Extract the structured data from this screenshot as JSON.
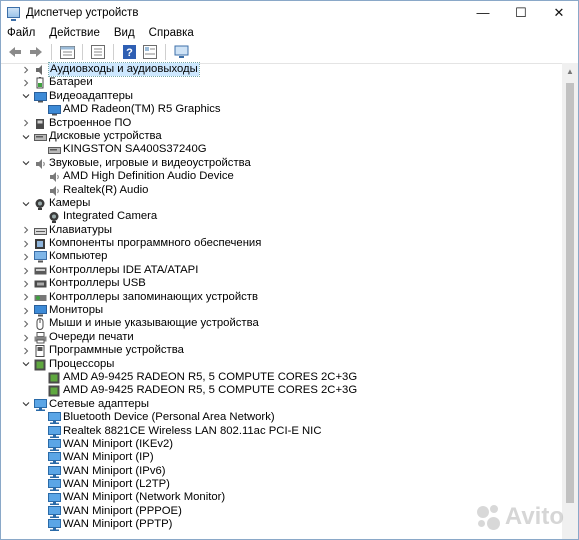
{
  "window": {
    "title": "Диспетчер устройств",
    "minimize": "—",
    "maximize": "☐",
    "close": "✕"
  },
  "menu": [
    "Файл",
    "Действие",
    "Вид",
    "Справка"
  ],
  "toolbar": [
    "back-arrow-icon",
    "forward-arrow-icon",
    "properties-icon",
    "list-icon",
    "help-icon",
    "scan-hardware-icon"
  ],
  "tree": [
    {
      "level": 0,
      "expand": ">",
      "icon": "audio-io-icon",
      "label": "Аудиовходы и аудиовыходы",
      "selected": true
    },
    {
      "level": 0,
      "expand": ">",
      "icon": "battery-icon",
      "label": "Батареи"
    },
    {
      "level": 0,
      "expand": "v",
      "icon": "display-adapter-icon",
      "label": "Видеоадаптеры"
    },
    {
      "level": 1,
      "icon": "display-adapter-icon",
      "label": "AMD Radeon(TM) R5 Graphics"
    },
    {
      "level": 0,
      "expand": ">",
      "icon": "firmware-icon",
      "label": "Встроенное ПО"
    },
    {
      "level": 0,
      "expand": "v",
      "icon": "disk-icon",
      "label": "Дисковые устройства"
    },
    {
      "level": 1,
      "icon": "disk-icon",
      "label": "KINGSTON SA400S37240G"
    },
    {
      "level": 0,
      "expand": "v",
      "icon": "speaker-icon",
      "label": "Звуковые, игровые и видеоустройства"
    },
    {
      "level": 1,
      "icon": "speaker-icon",
      "label": "AMD High Definition Audio Device"
    },
    {
      "level": 1,
      "icon": "speaker-icon",
      "label": "Realtek(R) Audio"
    },
    {
      "level": 0,
      "expand": "v",
      "icon": "camera-icon",
      "label": "Камеры"
    },
    {
      "level": 1,
      "icon": "camera-icon",
      "label": "Integrated Camera"
    },
    {
      "level": 0,
      "expand": ">",
      "icon": "keyboard-icon",
      "label": "Клавиатуры"
    },
    {
      "level": 0,
      "expand": ">",
      "icon": "software-component-icon",
      "label": "Компоненты программного обеспечения"
    },
    {
      "level": 0,
      "expand": ">",
      "icon": "computer-icon",
      "label": "Компьютер"
    },
    {
      "level": 0,
      "expand": ">",
      "icon": "ide-controller-icon",
      "label": "Контроллеры IDE ATA/ATAPI"
    },
    {
      "level": 0,
      "expand": ">",
      "icon": "usb-icon",
      "label": "Контроллеры USB"
    },
    {
      "level": 0,
      "expand": ">",
      "icon": "storage-controller-icon",
      "label": "Контроллеры запоминающих устройств"
    },
    {
      "level": 0,
      "expand": ">",
      "icon": "monitor-icon",
      "label": "Мониторы"
    },
    {
      "level": 0,
      "expand": ">",
      "icon": "mouse-icon",
      "label": "Мыши и иные указывающие устройства"
    },
    {
      "level": 0,
      "expand": ">",
      "icon": "printer-icon",
      "label": "Очереди печати"
    },
    {
      "level": 0,
      "expand": ">",
      "icon": "software-device-icon",
      "label": "Программные устройства"
    },
    {
      "level": 0,
      "expand": "v",
      "icon": "processor-icon",
      "label": "Процессоры"
    },
    {
      "level": 1,
      "icon": "processor-icon",
      "label": "AMD A9-9425 RADEON R5, 5 COMPUTE CORES 2C+3G"
    },
    {
      "level": 1,
      "icon": "processor-icon",
      "label": "AMD A9-9425 RADEON R5, 5 COMPUTE CORES 2C+3G"
    },
    {
      "level": 0,
      "expand": "v",
      "icon": "network-adapter-icon",
      "label": "Сетевые адаптеры"
    },
    {
      "level": 1,
      "icon": "network-adapter-icon",
      "label": "Bluetooth Device (Personal Area Network)"
    },
    {
      "level": 1,
      "icon": "network-adapter-icon",
      "label": "Realtek 8821CE Wireless LAN 802.11ac PCI-E NIC"
    },
    {
      "level": 1,
      "icon": "network-adapter-icon",
      "label": "WAN Miniport (IKEv2)"
    },
    {
      "level": 1,
      "icon": "network-adapter-icon",
      "label": "WAN Miniport (IP)"
    },
    {
      "level": 1,
      "icon": "network-adapter-icon",
      "label": "WAN Miniport (IPv6)"
    },
    {
      "level": 1,
      "icon": "network-adapter-icon",
      "label": "WAN Miniport (L2TP)"
    },
    {
      "level": 1,
      "icon": "network-adapter-icon",
      "label": "WAN Miniport (Network Monitor)"
    },
    {
      "level": 1,
      "icon": "network-adapter-icon",
      "label": "WAN Miniport (PPPOE)"
    },
    {
      "level": 1,
      "icon": "network-adapter-icon",
      "label": "WAN Miniport (PPTP)"
    }
  ],
  "watermark": {
    "text": "Avito",
    "icon": "avito-logo-icon"
  },
  "colors": {
    "selection": "#cde8ff",
    "accent": "#0078d7"
  }
}
